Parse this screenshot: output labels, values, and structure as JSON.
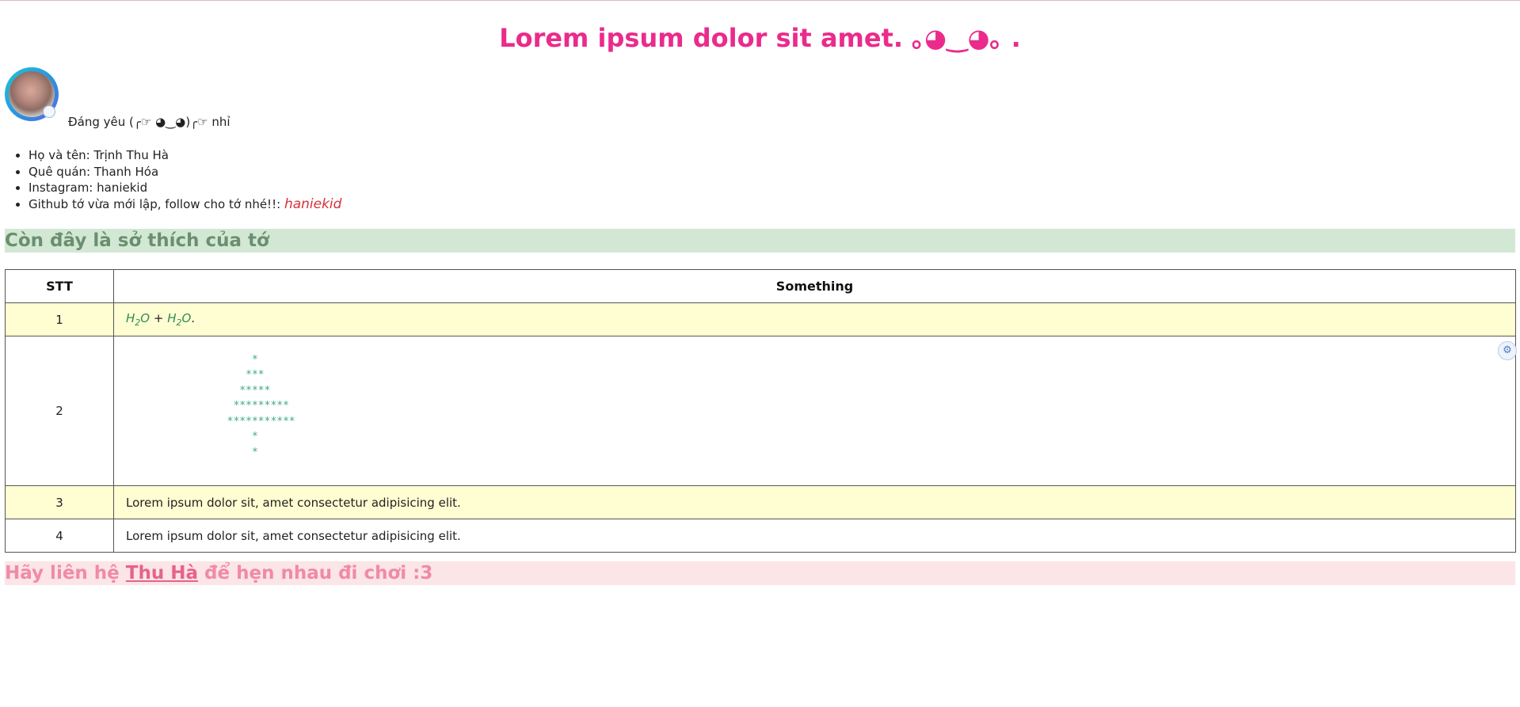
{
  "page": {
    "title": "Lorem ipsum dolor sit amet. ｡◕‿◕｡ ."
  },
  "intro": {
    "avatar_alt": "avatar",
    "text": "Đáng yêu (╭☞ ◕‿◕)╭☞ nhỉ"
  },
  "info": {
    "items": [
      "Họ và tên: Trịnh Thu Hà",
      "Quê quán: Thanh Hóa",
      "Instagram: haniekid"
    ],
    "github_prefix": "Github tớ vừa mới lập, follow cho tớ nhé!!:",
    "github_link": "haniekid"
  },
  "hobbies": {
    "heading": "Còn đây là sở thích của tớ",
    "columns": [
      "STT",
      "Something"
    ],
    "rows": [
      {
        "stt": "1",
        "formula_left": "H",
        "sub_left": "2",
        "o_left": "O",
        "plus": " + ",
        "formula_right": "H",
        "sub_right": "2",
        "o_right": "O",
        "dot": "."
      },
      {
        "stt": "2",
        "tree": "      *\n     ***\n    *****\n   *********\n  ***********\n      *\n      *"
      },
      {
        "stt": "3",
        "text": "Lorem ipsum dolor sit, amet consectetur adipisicing elit."
      },
      {
        "stt": "4",
        "text": "Lorem ipsum dolor sit, amet consectetur adipisicing elit."
      }
    ]
  },
  "contact": {
    "prefix": "Hãy liên hệ ",
    "link": "Thu Hà",
    "suffix": " để hẹn nhau đi chơi :3"
  },
  "icons": {
    "side_widget": "translate-icon"
  },
  "colors": {
    "title": "#ea2b8c",
    "hobby_heading_bg": "#d2e8d4",
    "hobby_heading_text": "#6b8f6e",
    "contact_heading_bg": "#fbe5e7",
    "contact_heading_text": "#f08aa7",
    "row_highlight": "#fffed2",
    "github_link": "#d6313a",
    "tree": "#3aa88a"
  }
}
